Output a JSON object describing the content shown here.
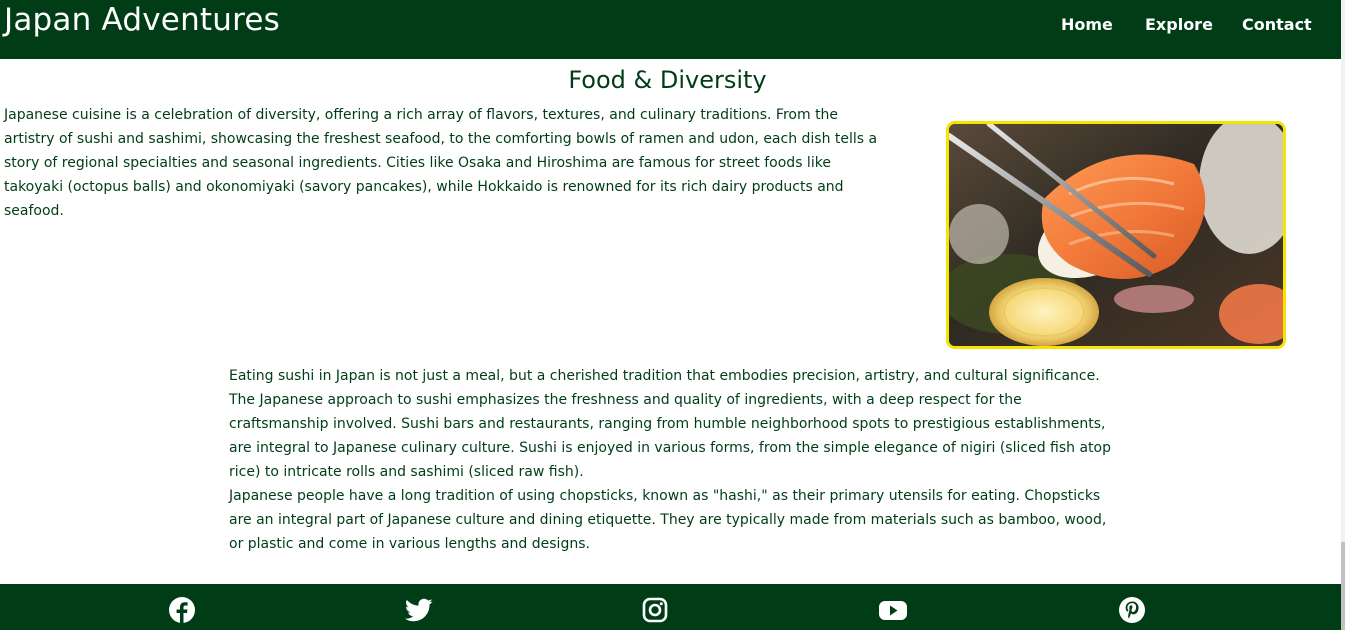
{
  "header": {
    "brand": "Japan Adventures",
    "nav": [
      "Home",
      "Explore",
      "Contact"
    ]
  },
  "main": {
    "title": "Food & Diversity",
    "intro": "Japanese cuisine is a celebration of diversity, offering a rich array of flavors, textures, and culinary traditions. From the artistry of sushi and sashimi, showcasing the freshest seafood, to the comforting bowls of ramen and udon, each dish tells a story of regional specialties and seasonal ingredients. Cities like Osaka and Hiroshima are famous for street foods like takoyaki (octopus balls) and okonomiyaki (savory pancakes), while Hokkaido is renowned for its rich dairy products and seafood.",
    "sushi_paragraph": "Eating sushi in Japan is not just a meal, but a cherished tradition that embodies precision, artistry, and cultural significance. The Japanese approach to sushi emphasizes the freshness and quality of ingredients, with a deep respect for the craftsmanship involved. Sushi bars and restaurants, ranging from humble neighborhood spots to prestigious establishments, are integral to Japanese culinary culture. Sushi is enjoyed in various forms, from the simple elegance of nigiri (sliced fish atop rice) to intricate rolls and sashimi (sliced raw fish).",
    "chopsticks_paragraph": "Japanese people have a long tradition of using chopsticks, known as \"hashi,\" as their primary utensils for eating. Chopsticks are an integral part of Japanese culture and dining etiquette. They are typically made from materials such as bamboo, wood, or plastic and come in various lengths and designs."
  },
  "footer": {
    "social_icons": [
      "facebook-icon",
      "twitter-icon",
      "instagram-icon",
      "youtube-icon",
      "pinterest-icon"
    ]
  },
  "colors": {
    "primary_green": "#003d17",
    "photo_border": "#f5e400",
    "text_on_dark": "#ffffff"
  }
}
